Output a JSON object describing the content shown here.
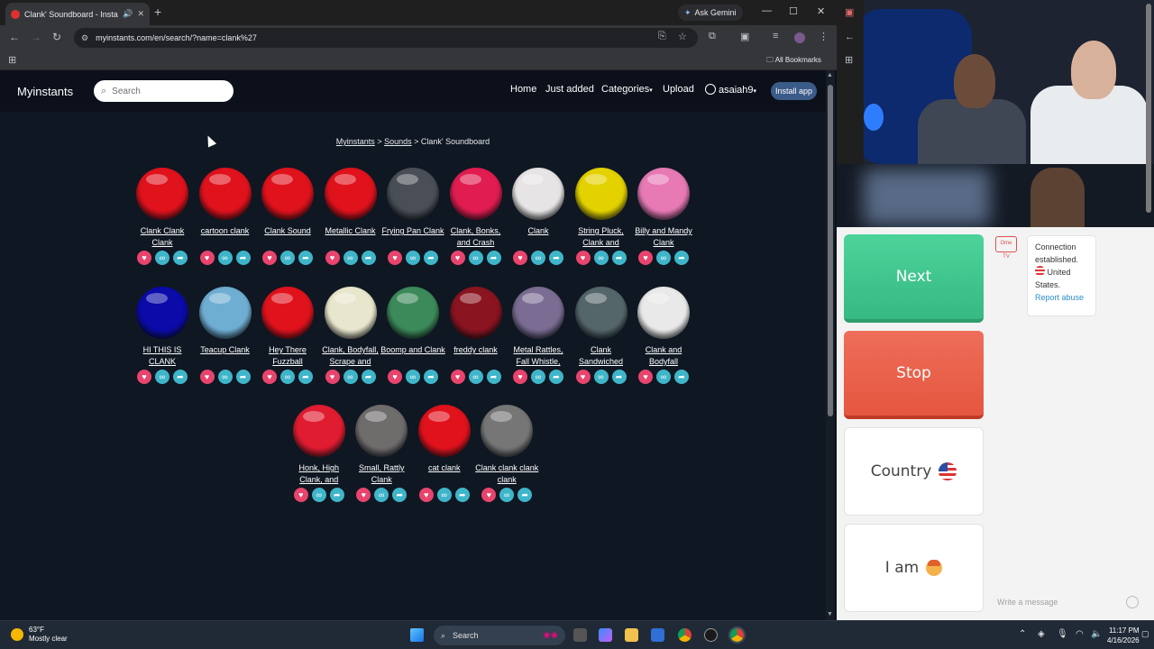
{
  "browser": {
    "tab_title": "Clank' Soundboard - Instan",
    "ask_gemini": "Ask Gemini",
    "url": "myinstants.com/en/search/?name=clank%27",
    "all_bookmarks": "All Bookmarks"
  },
  "site": {
    "logo": "Myinstants",
    "search_placeholder": "Search",
    "nav": {
      "home": "Home",
      "just_added": "Just added",
      "categories": "Categories",
      "upload": "Upload",
      "user": "asaiah9",
      "install": "Install app"
    },
    "breadcrumb": {
      "home": "Myinstants",
      "sounds": "Sounds",
      "current": "Clank' Soundboard"
    },
    "sounds": [
      {
        "label": "Clank Clank Clank",
        "color": "#e0121c"
      },
      {
        "label": "cartoon clank",
        "color": "#e0121c"
      },
      {
        "label": "Clank Sound",
        "color": "#e0121c"
      },
      {
        "label": "Metallic Clank",
        "color": "#e0121c"
      },
      {
        "label": "Frying Pan Clank",
        "color": "#4a4f57"
      },
      {
        "label": "Clank, Bonks, and Crash",
        "color": "#e01c50"
      },
      {
        "label": "Clank",
        "color": "#e6e4e4"
      },
      {
        "label": "String Pluck, Clank and",
        "color": "#e3d200"
      },
      {
        "label": "Billy and Mandy Clank",
        "color": "#e77ab5"
      },
      {
        "label": "HI THIS IS CLANK",
        "color": "#0a0ba8"
      },
      {
        "label": "Teacup Clank",
        "color": "#6faed3"
      },
      {
        "label": "Hey There Fuzzball",
        "color": "#e0121c"
      },
      {
        "label": "Clank, Bodyfall, Scrape and",
        "color": "#e8e6cc"
      },
      {
        "label": "Boomp and Clank",
        "color": "#3c8a5a"
      },
      {
        "label": "freddy clank",
        "color": "#8a1420"
      },
      {
        "label": "Metal Rattles, Fall Whistle,",
        "color": "#7a6c92"
      },
      {
        "label": "Clank Sandwiched",
        "color": "#55666a"
      },
      {
        "label": "Clank and Bodyfall",
        "color": "#e9e9e9"
      },
      {
        "label": "Honk, High Clank, and",
        "color": "#e01c30"
      },
      {
        "label": "Small, Rattly Clank",
        "color": "#6f6c6c"
      },
      {
        "label": "cat clank",
        "color": "#e0121c"
      },
      {
        "label": "Clank clank clank clank",
        "color": "#767676"
      }
    ]
  },
  "right_panel": {
    "next": "Next",
    "stop": "Stop",
    "country": "Country",
    "iam": "I am",
    "chat_logo": "Ome TV",
    "chat": {
      "line1": "Connection",
      "line2": "established.",
      "line3": "United",
      "line4": "States.",
      "report": "Report abuse"
    },
    "message_placeholder": "Write a message"
  },
  "taskbar": {
    "temp": "63°F",
    "weather": "Mostly clear",
    "search": "Search",
    "time": "11:17 PM",
    "date": "4/16/2026"
  }
}
